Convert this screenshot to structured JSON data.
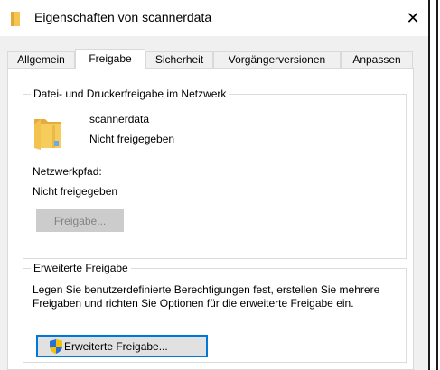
{
  "window": {
    "title": "Eigenschaften von scannerdata"
  },
  "tabs": [
    {
      "label": "Allgemein"
    },
    {
      "label": "Freigabe"
    },
    {
      "label": "Sicherheit"
    },
    {
      "label": "Vorgängerversionen"
    },
    {
      "label": "Anpassen"
    }
  ],
  "network_sharing": {
    "group_label": "Datei- und Druckerfreigabe im Netzwerk",
    "folder_name": "scannerdata",
    "share_status": "Nicht freigegeben",
    "path_label": "Netzwerkpfad:",
    "path_value": "Nicht freigegeben",
    "share_button": "Freigabe..."
  },
  "advanced_sharing": {
    "group_label": "Erweiterte Freigabe",
    "description": "Legen Sie benutzerdefinierte Berechtigungen fest, erstellen Sie mehrere Freigaben und richten Sie Optionen für die erweiterte Freigabe ein.",
    "button": "Erweiterte Freigabe..."
  },
  "colors": {
    "folder_yellow": "#f4c650",
    "shield_blue": "#2a6fd6",
    "shield_yellow": "#f5c400",
    "focus_blue": "#0078d7"
  }
}
